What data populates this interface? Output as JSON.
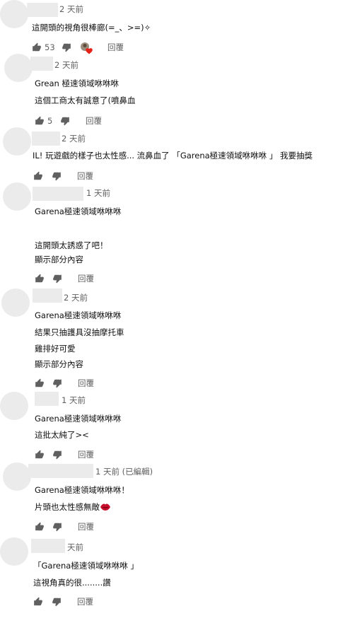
{
  "comments": [
    {
      "time": "2 天前",
      "lines": [
        "這開頭的視角很棒廊(=_、>=)✧"
      ],
      "likes": "53",
      "reply": "回覆",
      "creator_heart": true
    },
    {
      "time": "2 天前",
      "lines": [
        "Grean 極速領域咻咻咻",
        "這個工商太有誠意了(噴鼻血"
      ],
      "likes": "5",
      "reply": "回覆"
    },
    {
      "time": "2 天前",
      "lines": [
        "IL! 玩遊戲的樣子也太性感...  流鼻血了 「Garena極速領域咻咻咻 」 我要抽獎"
      ],
      "likes": "",
      "reply": "回覆"
    },
    {
      "time": "1 天前",
      "lines": [
        "Garena極速領域咻咻咻",
        "",
        "這開頭太誘惑了吧！",
        "顯示部分內容"
      ],
      "likes": "",
      "reply": "回覆"
    },
    {
      "time": "2 天前",
      "lines": [
        "Garena極速領域咻咻咻",
        "結果只抽護具沒抽摩托車",
        "雞排好可愛",
        "顯示部分內容"
      ],
      "likes": "",
      "reply": "回覆"
    },
    {
      "time": "1 天前",
      "lines": [
        "Garena極速領域咻咻咻",
        "這批太純了><"
      ],
      "likes": "",
      "reply": "回覆"
    },
    {
      "time": "1 天前 (已編輯)",
      "lines": [
        "Garena極速領域咻咻咻！",
        "片頭也太性感無敵"
      ],
      "likes": "",
      "reply": "回覆",
      "lips_emoji": true
    },
    {
      "time": "天前",
      "lines": [
        "「Garena極速領域咻咻咻 」",
        "這視角真的很........讚"
      ],
      "likes": "",
      "reply": "回覆"
    }
  ],
  "icons": {
    "like": "thumb-up-icon",
    "dislike": "thumb-down-icon",
    "heart": "creator-heart-icon",
    "lips": "lips-emoji"
  },
  "colors": {
    "placeholder": "#ebebeb",
    "secondary_text": "#606060",
    "primary_text": "#0f0f0f",
    "heart": "#e62117"
  }
}
